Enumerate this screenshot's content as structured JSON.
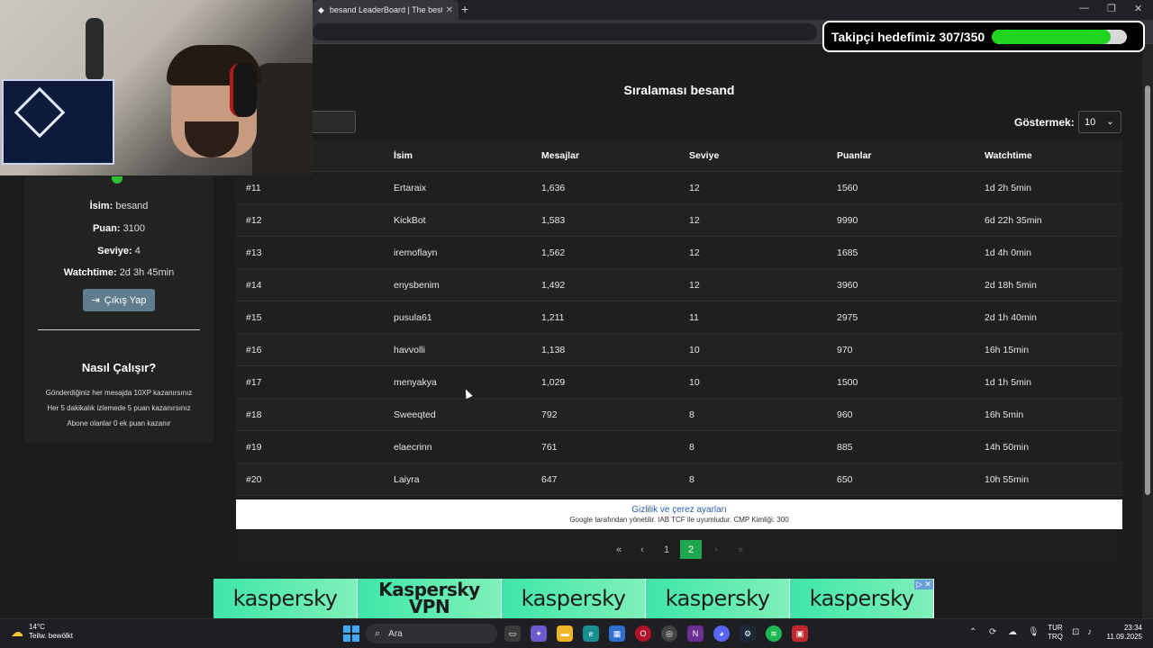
{
  "browser": {
    "tab_title": "besand LeaderBoard | The best C",
    "tab_close": "✕",
    "new_tab": "+",
    "win_min": "—",
    "win_max": "❐",
    "win_close": "✕"
  },
  "overlay": {
    "goal_text": "Takipçi hedefimiz 307/350",
    "goal_progress": 0.877,
    "goal_color": "#1fd41f"
  },
  "profile": {
    "name_label": "İsim:",
    "name_value": "besand",
    "points_label": "Puan:",
    "points_value": "3100",
    "level_label": "Seviye:",
    "level_value": "4",
    "watch_label": "Watchtime:",
    "watch_value": "2d 3h 45min",
    "logout_label": "Çıkış Yap"
  },
  "howto": {
    "title": "Nasıl Çalışır?",
    "rules": [
      "Gönderdiğiniz her mesajda 10XP kazanırsınız",
      "Her 5 dakikalık izlemede 5 puan kazanırsınız",
      "Abone olanlar 0 ek puan kazanır"
    ]
  },
  "leaderboard": {
    "title": "Sıralaması besand",
    "show_label": "Göstermek:",
    "show_value": "10",
    "columns": [
      "",
      "İsim",
      "Mesajlar",
      "Seviye",
      "Puanlar",
      "Watchtime"
    ],
    "rows": [
      [
        "#11",
        "Ertaraix",
        "1,636",
        "12",
        "1560",
        "1d 2h 5min"
      ],
      [
        "#12",
        "KickBot",
        "1,583",
        "12",
        "9990",
        "6d 22h 35min"
      ],
      [
        "#13",
        "iremoflayn",
        "1,562",
        "12",
        "1685",
        "1d 4h 0min"
      ],
      [
        "#14",
        "enysbenim",
        "1,492",
        "12",
        "3960",
        "2d 18h 5min"
      ],
      [
        "#15",
        "pusula61",
        "1,211",
        "11",
        "2975",
        "2d 1h 40min"
      ],
      [
        "#16",
        "havvolli",
        "1,138",
        "10",
        "970",
        "16h 15min"
      ],
      [
        "#17",
        "menyakya",
        "1,029",
        "10",
        "1500",
        "1d 1h 5min"
      ],
      [
        "#18",
        "Sweeqted",
        "792",
        "8",
        "960",
        "16h 5min"
      ],
      [
        "#19",
        "elaecrinn",
        "761",
        "8",
        "885",
        "14h 50min"
      ],
      [
        "#20",
        "Laiyra",
        "647",
        "8",
        "650",
        "10h 55min"
      ]
    ]
  },
  "cookie": {
    "link": "Gizlilik ve çerez ayarları",
    "note": "Google tarafından yönetilir. IAB TCF ile uyumludur. CMP Kimliği: 300"
  },
  "pagination": {
    "first": "«",
    "prev": "‹",
    "pages": [
      "1",
      "2"
    ],
    "active": "2",
    "next": "›",
    "last": "»"
  },
  "ad": {
    "cells": [
      "kaspersky",
      "Kaspersky",
      "kaspersky",
      "kaspersky",
      "kaspersky"
    ],
    "vpn_line1": "Kaspersky",
    "vpn_line2": "VPN",
    "badge": "▷ ✕"
  },
  "taskbar": {
    "temp": "14°C",
    "weather": "Teilw. bewölkt",
    "search_placeholder": "Ara",
    "lang_top": "TUR",
    "lang_bottom": "TRQ",
    "time": "23:34",
    "date": "11.09.2025"
  }
}
